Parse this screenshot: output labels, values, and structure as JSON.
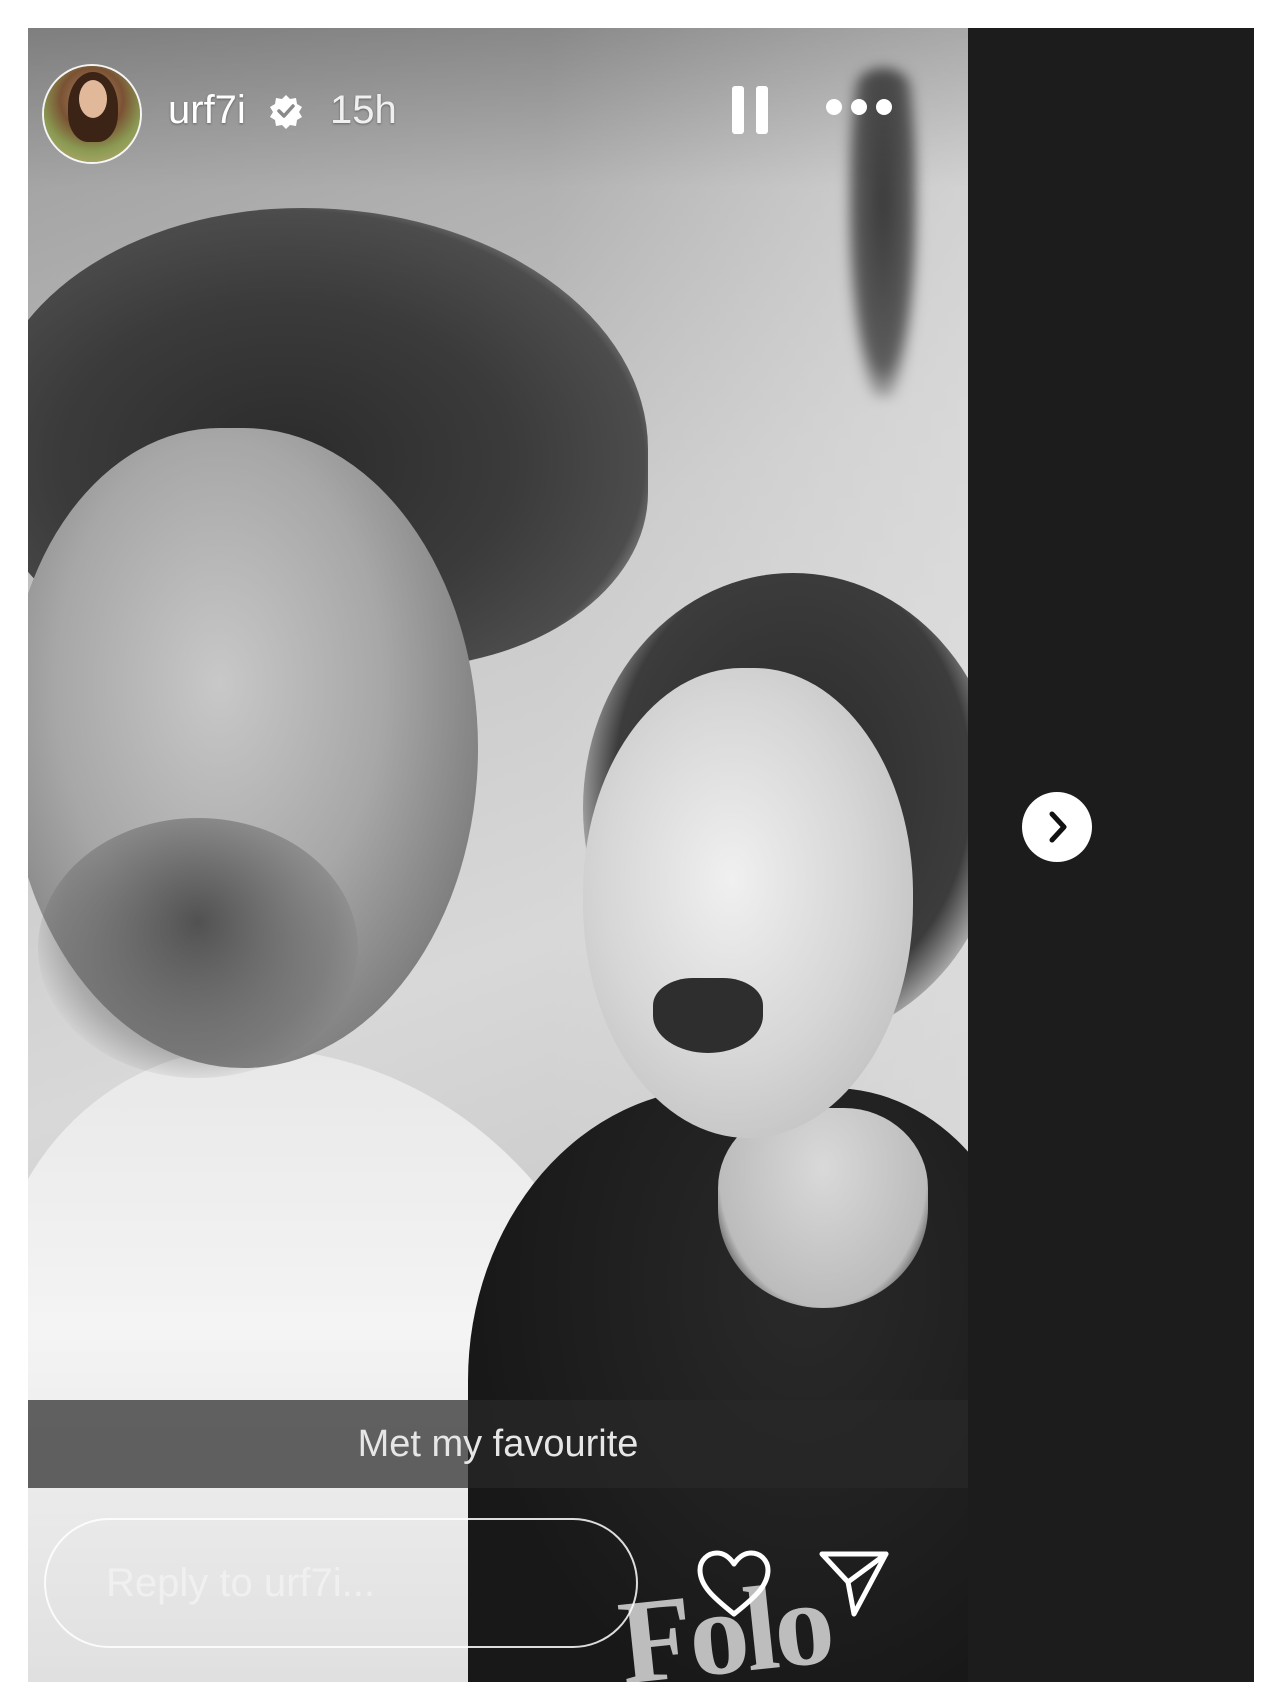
{
  "story": {
    "username": "urf7i",
    "timestamp": "15h",
    "caption": "Met my favourite",
    "verified": true,
    "shirt_print_text": "Folo"
  },
  "reply": {
    "placeholder": "Reply to urf7i..."
  },
  "icons": {
    "verified": "verified-badge-icon",
    "pause": "pause-icon",
    "more": "more-horizontal-icon",
    "like": "heart-icon",
    "share": "send-icon",
    "next": "chevron-right-icon"
  },
  "colors": {
    "background": "#1c1c1c",
    "text": "#ffffff",
    "caption_band": "#282828"
  }
}
